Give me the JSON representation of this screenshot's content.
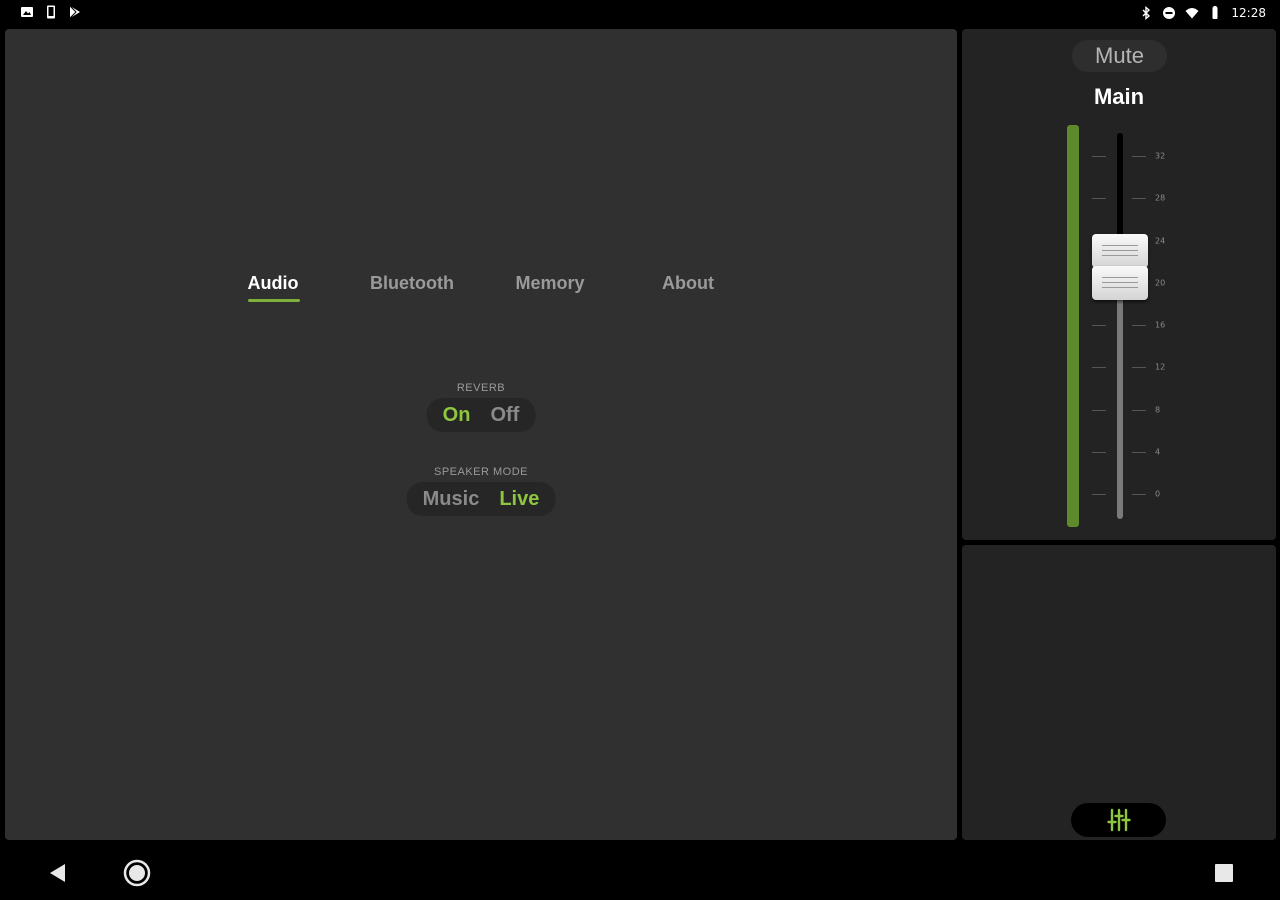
{
  "status_bar": {
    "time": "12:28",
    "left_icons": [
      "image-notification-icon",
      "phone-notification-icon",
      "play-store-notification-icon"
    ],
    "right_icons": [
      "bluetooth-icon",
      "do-not-disturb-icon",
      "wifi-icon",
      "battery-icon"
    ]
  },
  "tabs": [
    {
      "label": "Audio",
      "active": true
    },
    {
      "label": "Bluetooth",
      "active": false
    },
    {
      "label": "Memory",
      "active": false
    },
    {
      "label": "About",
      "active": false
    }
  ],
  "settings": {
    "reverb": {
      "label": "REVERB",
      "options": [
        "On",
        "Off"
      ],
      "selected": "On"
    },
    "speaker_mode": {
      "label": "SPEAKER MODE",
      "options": [
        "Music",
        "Live"
      ],
      "selected": "Live"
    }
  },
  "mixer": {
    "mute_label": "Mute",
    "channel_name": "Main",
    "scale_labels": [
      "32",
      "28",
      "24",
      "20",
      "16",
      "12",
      "8",
      "4",
      "0"
    ],
    "meter_level": 1.0,
    "fader_values": [
      23,
      20
    ]
  },
  "colors": {
    "accent": "#8fc63f",
    "meter": "#5f8a2b",
    "panel": "#303030",
    "side_panel": "#232323"
  },
  "nav": {
    "icons": [
      "back-icon",
      "home-icon",
      "recents-icon"
    ]
  }
}
